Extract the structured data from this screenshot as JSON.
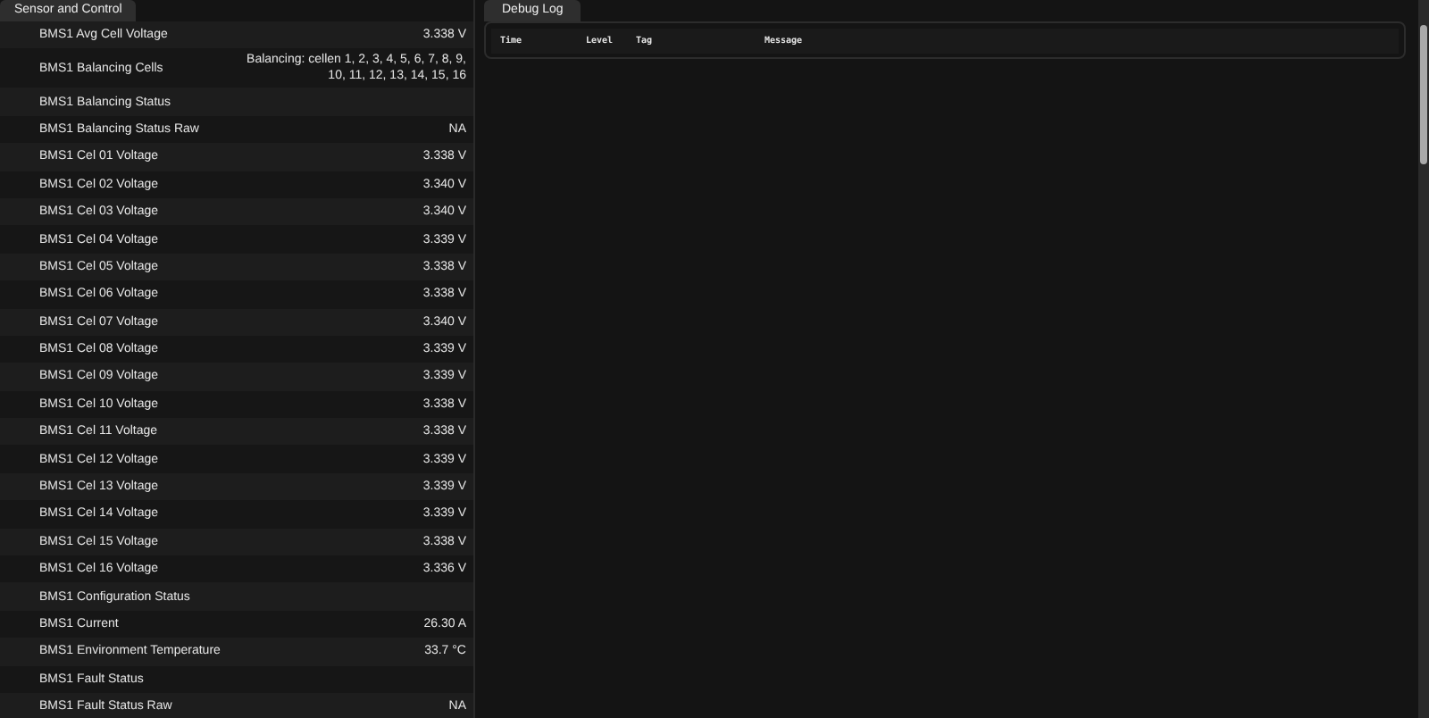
{
  "sensor_panel": {
    "tab": {
      "label": "Sensor and Control",
      "selected": true
    },
    "rows": [
      {
        "name": "BMS1 Avg Cell Voltage",
        "value": "3.338 V"
      },
      {
        "name": "BMS1 Balancing Cells",
        "value": "Balancing: cellen 1, 2, 3, 4, 5, 6, 7, 8, 9, 10, 11, 12, 13, 14, 15, 16"
      },
      {
        "name": "BMS1 Balancing Status"
      },
      {
        "name": "BMS1 Balancing Status Raw",
        "value": "NA"
      },
      {
        "name": "BMS1 Cel 01 Voltage",
        "value": "3.338 V"
      },
      {
        "name": "BMS1 Cel 02 Voltage",
        "value": "3.340 V"
      },
      {
        "name": "BMS1 Cel 03 Voltage",
        "value": "3.340 V"
      },
      {
        "name": "BMS1 Cel 04 Voltage",
        "value": "3.339 V"
      },
      {
        "name": "BMS1 Cel 05 Voltage",
        "value": "3.338 V"
      },
      {
        "name": "BMS1 Cel 06 Voltage",
        "value": "3.338 V"
      },
      {
        "name": "BMS1 Cel 07 Voltage",
        "value": "3.340 V"
      },
      {
        "name": "BMS1 Cel 08 Voltage",
        "value": "3.339 V"
      },
      {
        "name": "BMS1 Cel 09 Voltage",
        "value": "3.339 V"
      },
      {
        "name": "BMS1 Cel 10 Voltage",
        "value": "3.338 V"
      },
      {
        "name": "BMS1 Cel 11 Voltage",
        "value": "3.338 V"
      },
      {
        "name": "BMS1 Cel 12 Voltage",
        "value": "3.339 V"
      },
      {
        "name": "BMS1 Cel 13 Voltage",
        "value": "3.339 V"
      },
      {
        "name": "BMS1 Cel 14 Voltage",
        "value": "3.339 V"
      },
      {
        "name": "BMS1 Cel 15 Voltage",
        "value": "3.338 V"
      },
      {
        "name": "BMS1 Cel 16 Voltage",
        "value": "3.336 V"
      },
      {
        "name": "BMS1 Configuration Status"
      },
      {
        "name": "BMS1 Current",
        "value": "26.30 A"
      },
      {
        "name": "BMS1 Environment Temperature",
        "value": "33.7 °C"
      },
      {
        "name": "BMS1 Fault Status"
      },
      {
        "name": "BMS1 Fault Status Raw",
        "value": "NA"
      }
    ]
  },
  "debug_panel": {
    "tab": {
      "label": "Debug Log",
      "selected": true
    },
    "columns": [
      "Time",
      "Level",
      "Tag",
      "Message"
    ]
  }
}
